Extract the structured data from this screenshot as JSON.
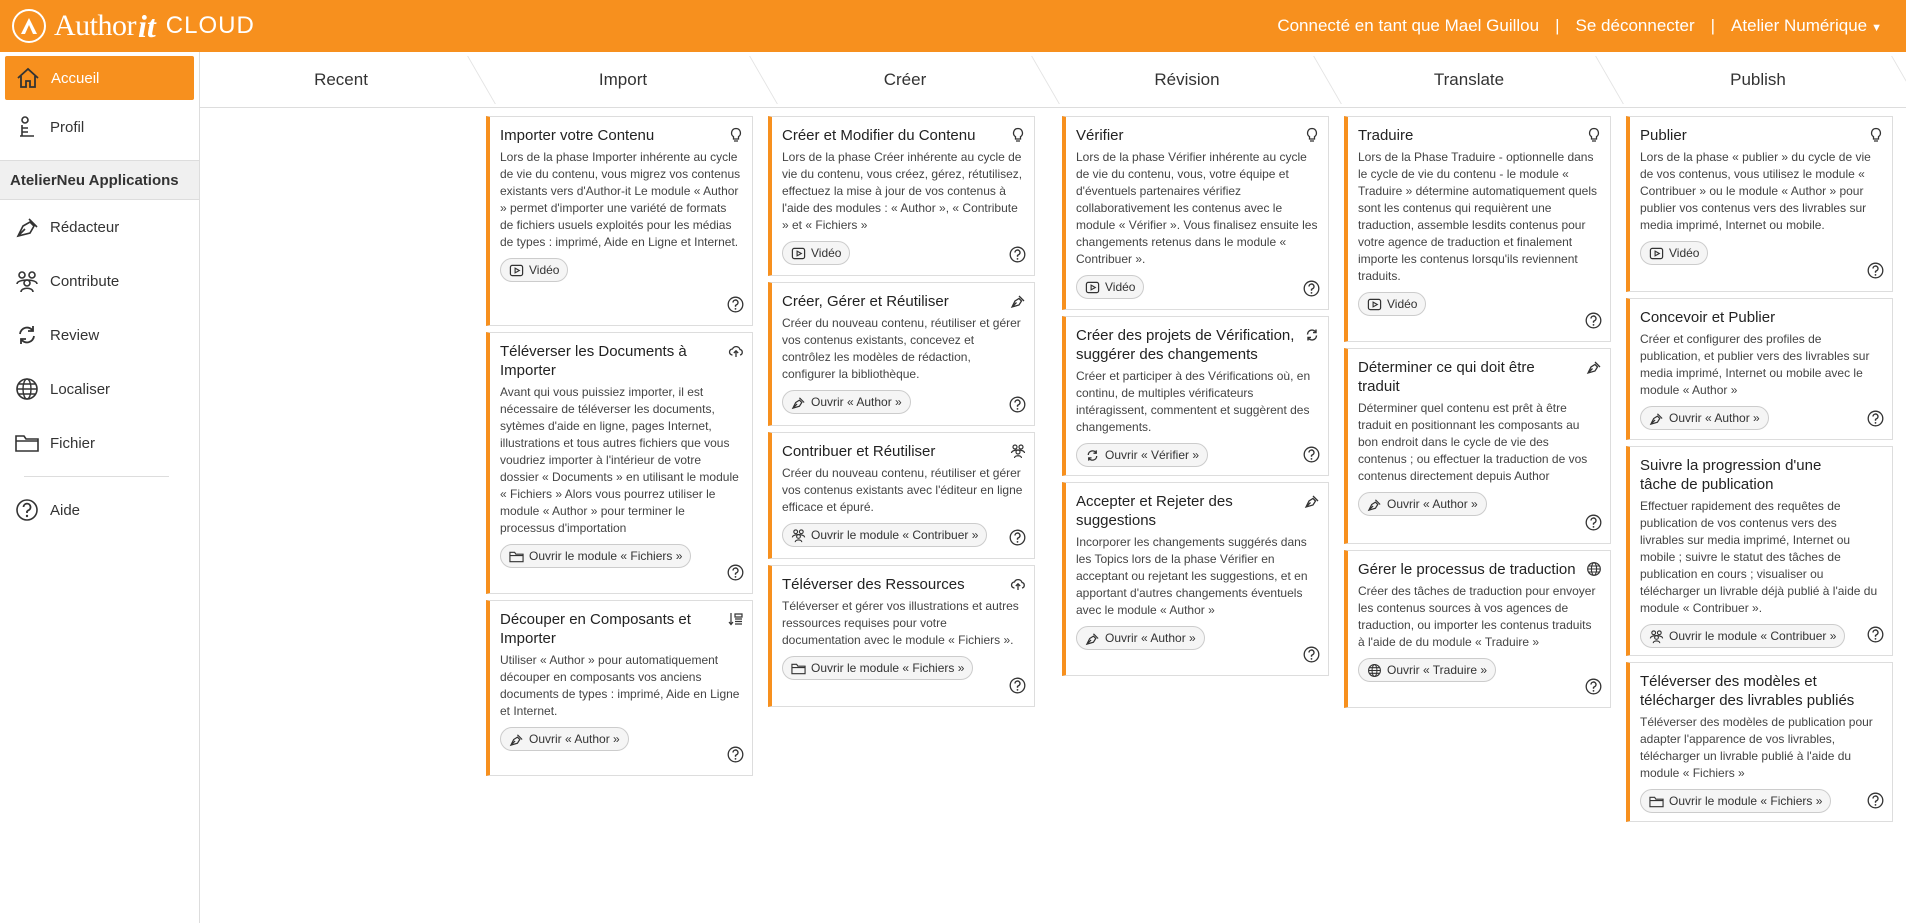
{
  "header": {
    "logo_author": "Author",
    "logo_it": "it",
    "logo_cloud": "CLOUD",
    "connected": "Connecté en tant que Mael Guillou",
    "sep": "|",
    "logout": "Se déconnecter",
    "workspace": "Atelier Numérique"
  },
  "sidebar": {
    "items": [
      {
        "label": "Accueil",
        "icon": "home-icon"
      },
      {
        "label": "Profil",
        "icon": "profile-icon"
      }
    ],
    "section": "AtelierNeu Applications",
    "apps": [
      {
        "label": "Rédacteur",
        "icon": "pen-icon"
      },
      {
        "label": "Contribute",
        "icon": "users-icon"
      },
      {
        "label": "Review",
        "icon": "refresh-icon"
      },
      {
        "label": "Localiser",
        "icon": "globe-icon"
      },
      {
        "label": "Fichier",
        "icon": "folder-icon"
      }
    ],
    "help": "Aide"
  },
  "columns": [
    "Recent",
    "Import",
    "Créer",
    "Révision",
    "Translate",
    "Publish"
  ],
  "cards": {
    "import": [
      {
        "title": "Importer votre Contenu",
        "desc": "Lors de la phase Importer inhérente au cycle de vie du contenu, vous migrez vos contenus existants vers d'Author-it Le module « Author » permet d'importer une variété de formats de fichiers usuels exploités pour les médias de types : imprimé, Aide en Ligne et Internet.",
        "button": "Vidéo"
      },
      {
        "title": "Téléverser les Documents à Importer",
        "desc": "Avant qui vous puissiez importer, il est nécessaire de téléverser les documents, sytèmes d'aide en ligne, pages Internet, illustrations et tous autres fichiers que vous voudriez importer à l'intérieur de votre dossier « Documents » en utilisant le module « Fichiers » Alors vous pourrez utiliser le module « Author » pour terminer le processus d'importation",
        "button": "Ouvrir le module « Fichiers »"
      },
      {
        "title": "Découper en Composants et Importer",
        "desc": "Utiliser « Author » pour automatiquement découper en composants vos anciens documents de types : imprimé, Aide en Ligne et Internet.",
        "button": "Ouvrir « Author »"
      }
    ],
    "creer": [
      {
        "title": "Créer et Modifier du Contenu",
        "desc": "Lors de la phase Créer inhérente au cycle de vie du contenu, vous créez, gérez, rétutilisez, effectuez la mise à jour de vos contenus à l'aide des modules : « Author », « Contribute » et « Fichiers »",
        "button": "Vidéo"
      },
      {
        "title": "Créer, Gérer et Réutiliser",
        "desc": "Créer du nouveau contenu, réutiliser et gérer vos contenus existants, concevez et contrôlez les modèles de rédaction, configurer la bibliothèque.",
        "button": "Ouvrir « Author »"
      },
      {
        "title": "Contribuer et Réutiliser",
        "desc": "Créer du nouveau contenu, réutiliser et gérer vos contenus existants avec l'éditeur en ligne efficace et épuré.",
        "button": "Ouvrir le module « Contribuer »"
      },
      {
        "title": "Téléverser des Ressources",
        "desc": "Téléverser et gérer vos illustrations et autres ressources requises pour votre documentation avec le module « Fichiers ».",
        "button": "Ouvrir le module « Fichiers »"
      }
    ],
    "revision": [
      {
        "title": "Vérifier",
        "desc": "Lors de la phase Vérifier inhérente au cycle de vie du contenu, vous, votre équipe et d'éventuels partenaires vérifiez collaborativement les contenus avec le module « Vérifier ». Vous finalisez ensuite les changements retenus dans le module « Contribuer ».",
        "button": "Vidéo"
      },
      {
        "title": "Créer des projets de Vérification, suggérer des changements",
        "desc": "Créer et participer à des Vérifications où, en continu, de multiples vérificateurs intéragissent, commentent et suggèrent des changements.",
        "button": "Ouvrir « Vérifier »"
      },
      {
        "title": "Accepter et Rejeter des suggestions",
        "desc": "Incorporer les changements suggérés dans les Topics lors de la phase Vérifier en acceptant ou rejetant les suggestions, et en apportant d'autres changements éventuels avec le module « Author »",
        "button": "Ouvrir « Author »"
      }
    ],
    "translate": [
      {
        "title": "Traduire",
        "desc": "Lors de la Phase Traduire - optionnelle dans le cycle de vie du contenu - le module « Traduire » détermine automatiquement quels sont les contenus qui requièrent une traduction, assemble lesdits contenus pour votre agence de traduction et finalement importe les contenus lorsqu'ils reviennent traduits.",
        "button": "Vidéo"
      },
      {
        "title": "Déterminer ce qui doit être traduit",
        "desc": "Déterminer quel contenu est prêt à être traduit en positionnant les composants au bon endroit dans le cycle de vie des contenus ; ou effectuer la traduction de vos contenus directement depuis Author",
        "button": "Ouvrir « Author »"
      },
      {
        "title": "Gérer le processus de traduction",
        "desc": "Créer des tâches de traduction pour envoyer les contenus sources à vos agences de traduction, ou importer les contenus traduits à l'aide de du module « Traduire »",
        "button": "Ouvrir « Traduire »"
      }
    ],
    "publish": [
      {
        "title": "Publier",
        "desc": "Lors de la phase « publier » du cycle de vie de vos contenus, vous utilisez le module « Contribuer » ou le module « Author » pour publier vos contenus vers des livrables sur media imprimé, Internet ou mobile.",
        "button": "Vidéo"
      },
      {
        "title": "Concevoir et Publier",
        "desc": "Créer et configurer des profiles de publication, et publier vers des livrables sur media imprimé, Internet ou mobile avec le module « Author »",
        "button": "Ouvrir « Author »"
      },
      {
        "title": "Suivre la progression d'une tâche de publication",
        "desc": "Effectuer rapidement des requêtes de publication de vos contenus vers des livrables sur media imprimé, Internet ou mobile ; suivre le statut des tâches de publication en cours ; visualiser ou télécharger un livrable déjà publié à l'aide du module « Contribuer ».",
        "button": "Ouvrir le module « Contribuer »"
      },
      {
        "title": "Téléverser des modèles et télécharger des livrables publiés",
        "desc": "Téléverser des modèles de publication pour adapter l'apparence de vos livrables, télécharger un livrable publié à l'aide du module « Fichiers »",
        "button": "Ouvrir le module « Fichiers »"
      }
    ]
  },
  "colors": {
    "accent": "#f7901e"
  }
}
